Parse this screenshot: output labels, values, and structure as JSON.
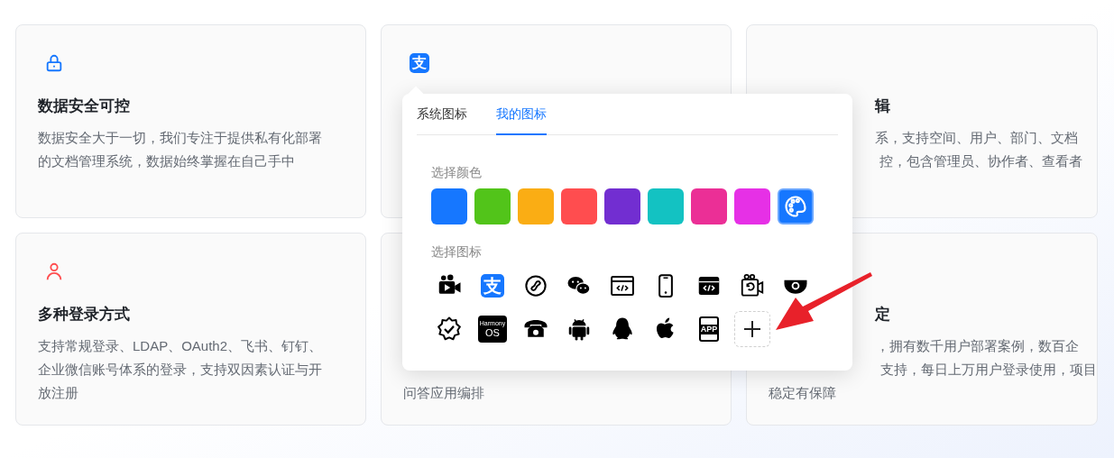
{
  "cards": [
    {
      "color": "#1677ff",
      "title": "数据安全可控",
      "lines": [
        "数据安全大于一切，我们专注于提供私有化部署",
        "的文档管理系统，数据始终掌握在自己手中"
      ]
    },
    {
      "color": "#1677ff",
      "glyph": "支"
    },
    {
      "title": "辑",
      "lines": [
        "系，支持空间、用户、部门、文档",
        "控，包含管理员、协作者、查看者"
      ]
    },
    {
      "color": "#ff4d4f",
      "title": "多种登录方式",
      "lines": [
        "支持常规登录、LDAP、OAuth2、飞书、钉钉、",
        "企业微信账号体系的登录，支持双因素认证与开",
        "放注册"
      ]
    },
    {
      "lines": [
        "问答应用编排"
      ]
    },
    {
      "title": "定",
      "lines": [
        "，拥有数千用户部署案例，数百企",
        "支持，每日上万用户登录使用，项目",
        "稳定有保障"
      ]
    }
  ],
  "popover": {
    "tabs": [
      {
        "label": "系统图标",
        "selected": false
      },
      {
        "label": "我的图标",
        "selected": true
      }
    ],
    "color_label": "选择颜色",
    "colors": [
      {
        "color": "#1677ff"
      },
      {
        "color": "#52c41a"
      },
      {
        "color": "#faad14"
      },
      {
        "color": "#ff4d4f"
      },
      {
        "color": "#722ed1"
      },
      {
        "color": "#13c2c2"
      },
      {
        "color": "#eb2f96"
      },
      {
        "color": "#e630e6"
      }
    ],
    "icon_label": "选择图标",
    "icons": [
      {
        "kind": "video",
        "selected": false
      },
      {
        "kind": "glyph",
        "label": "支",
        "selected": true
      },
      {
        "kind": "link",
        "selected": false
      },
      {
        "kind": "chat",
        "selected": false
      },
      {
        "kind": "code",
        "selected": false
      },
      {
        "kind": "phone",
        "selected": false
      },
      {
        "kind": "code_filled",
        "selected": false
      },
      {
        "kind": "camera_rotate",
        "selected": false
      },
      {
        "kind": "dome",
        "selected": false
      },
      {
        "kind": "badge",
        "selected": false
      },
      {
        "kind": "os",
        "label": "Harmony",
        "sublabel": "OS",
        "selected": false
      },
      {
        "kind": "telephone",
        "selected": false
      },
      {
        "kind": "android",
        "selected": false
      },
      {
        "kind": "penguin",
        "selected": false
      },
      {
        "kind": "apple",
        "selected": false
      },
      {
        "kind": "app",
        "label": "APP",
        "selected": false
      }
    ]
  }
}
